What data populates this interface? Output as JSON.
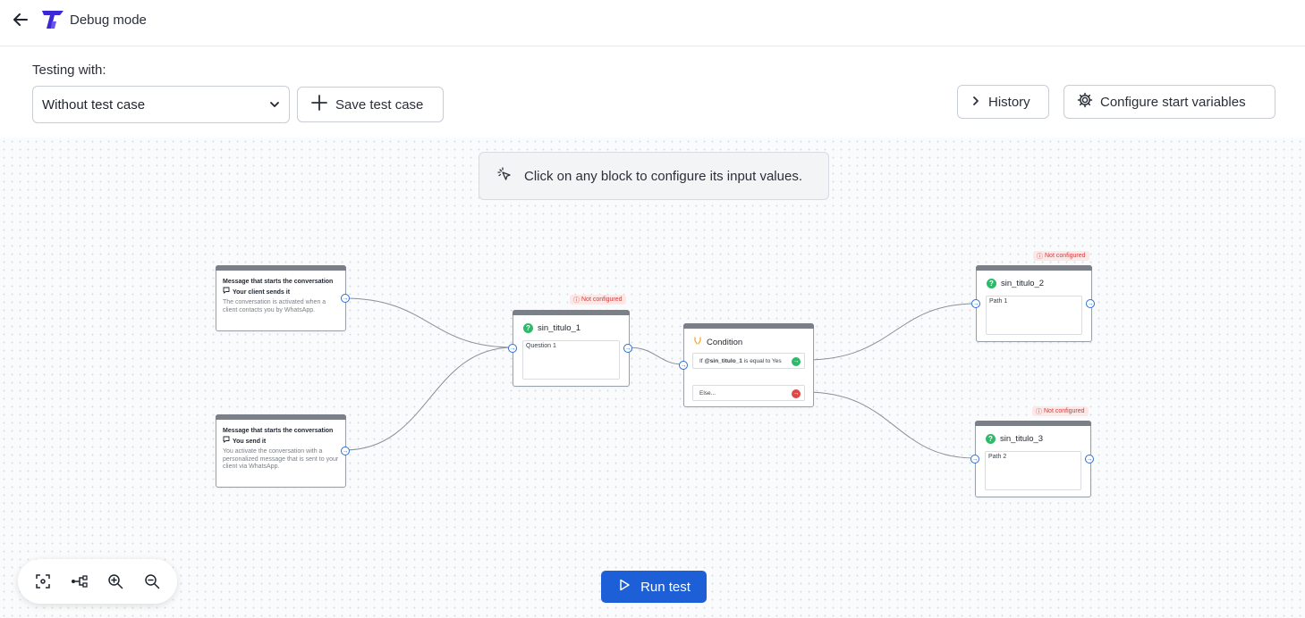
{
  "header": {
    "title": "Debug mode"
  },
  "toolbar": {
    "testing_label": "Testing with:",
    "test_case_value": "Without test case",
    "save_label": "Save test case",
    "history_label": "History",
    "configure_label": "Configure start variables"
  },
  "canvas": {
    "hint": "Click on any block to configure its input values.",
    "start_nodes": [
      {
        "title": "Message that starts the conversation",
        "trigger": "Your client sends it",
        "description": "The conversation is activated when a client contacts you by WhatsApp."
      },
      {
        "title": "Message that starts the conversation",
        "trigger": "You send it",
        "description": "You activate the conversation with a personalized message that is sent to your client via WhatsApp."
      }
    ],
    "question_nodes": [
      {
        "name": "sin_titulo_1",
        "body": "Question 1",
        "badge": "Not configured"
      },
      {
        "name": "sin_titulo_2",
        "body": "Path 1",
        "badge": "Not configured"
      },
      {
        "name": "sin_titulo_3",
        "body": "Path 2",
        "badge": "Not configured"
      }
    ],
    "condition": {
      "title": "Condition",
      "if_prefix": "If",
      "if_variable": "@sin_titulo_1",
      "if_suffix": "is equal to Yes",
      "else_label": "Else..."
    }
  },
  "footer": {
    "run_label": "Run test"
  },
  "colors": {
    "primary": "#1d5fd6",
    "success": "#2fba6b",
    "danger": "#e04848",
    "badge_bg": "#fde8e8",
    "condition_icon": "#f0a020"
  }
}
